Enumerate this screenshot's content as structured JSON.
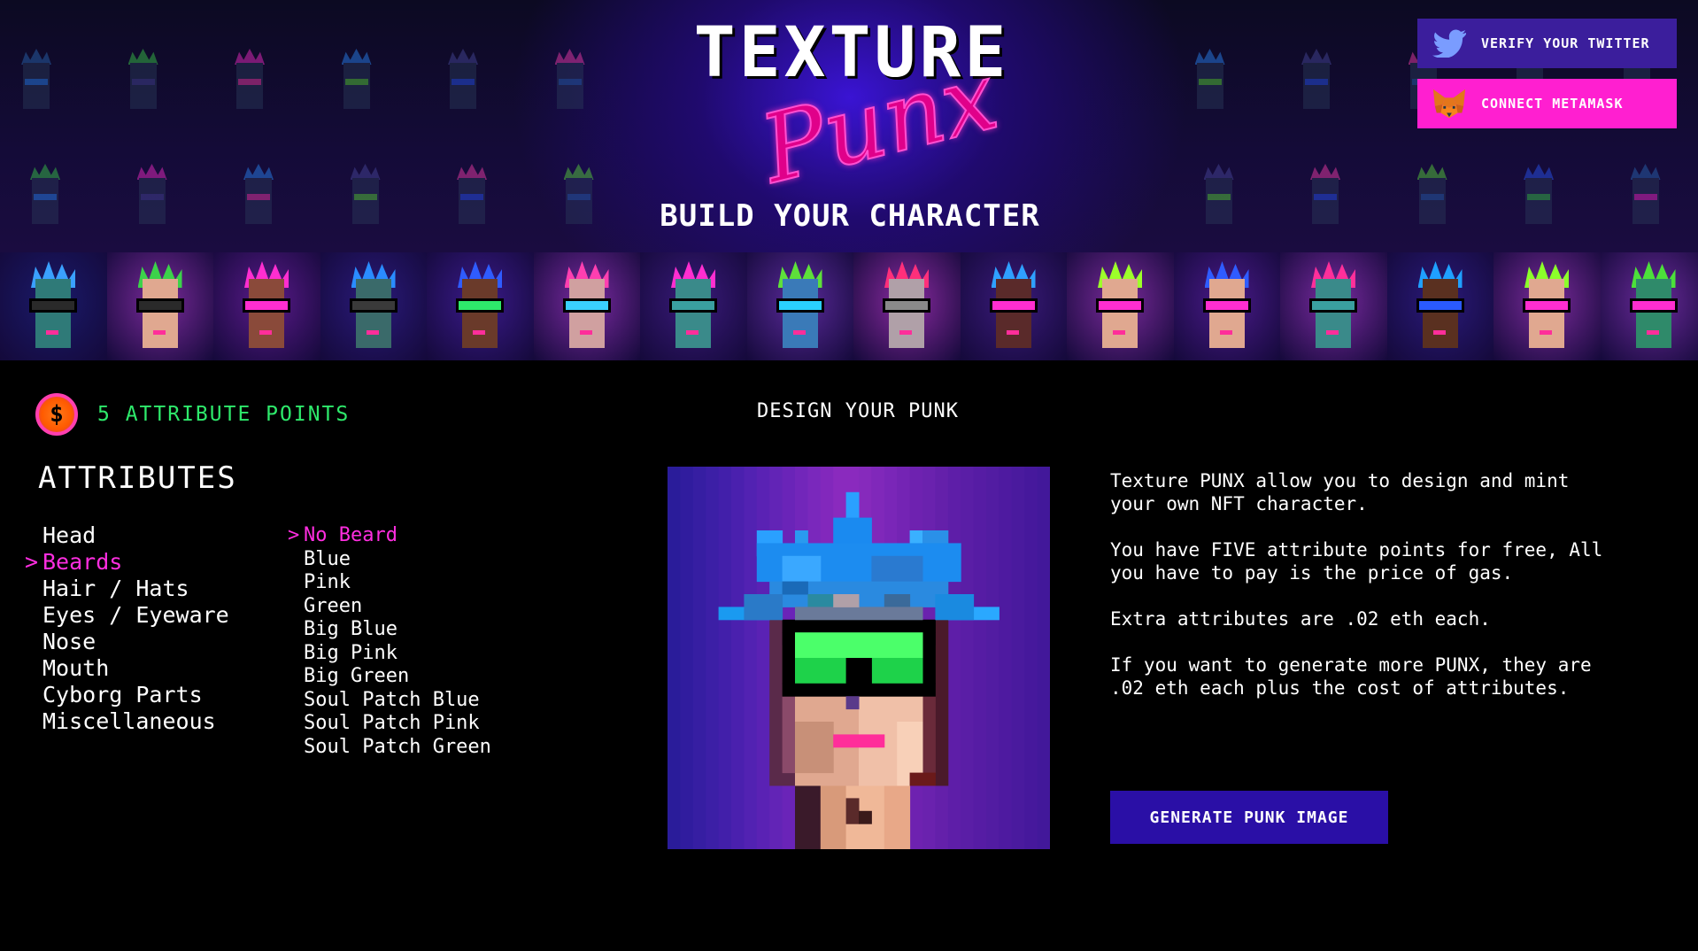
{
  "header": {
    "logo_title": "TEXTURE",
    "logo_script": "Punx",
    "tagline": "BUILD YOUR CHARACTER",
    "twitter_button": "VERIFY YOUR TWITTER",
    "metamask_button": "CONNECT METAMASK"
  },
  "points": {
    "icon": "coin-icon",
    "symbol": "$",
    "label": "5 ATTRIBUTE POINTS"
  },
  "design_title": "DESIGN YOUR PUNK",
  "attributes": {
    "heading": "ATTRIBUTES",
    "active_caret": ">",
    "categories": [
      "Head",
      "Beards",
      "Hair / Hats",
      "Eyes / Eyeware",
      "Nose",
      "Mouth",
      "Cyborg Parts",
      "Miscellaneous"
    ],
    "active_category": "Beards",
    "options": [
      "No Beard",
      "Blue",
      "Pink",
      "Green",
      "Big Blue",
      "Big Pink",
      "Big Green",
      "Soul Patch Blue",
      "Soul Patch Pink",
      "Soul Patch Green"
    ],
    "active_option": "No Beard"
  },
  "description": {
    "p1": "Texture PUNX allow you to design and mint your own NFT character.",
    "p2": "You have FIVE attribute points for free, All you have to pay is the price of gas.",
    "p3": "Extra attributes are .02 eth each.",
    "p4": "If you want to generate more PUNX, they are .02 eth each plus the cost of attributes."
  },
  "generate_button": "GENERATE PUNK IMAGE",
  "colors": {
    "accent_pink": "#ff2ee0",
    "accent_green": "#2ee96b",
    "button_purple": "#2a0fa6",
    "twitter_purple": "#3b1e9c",
    "metamask_pink": "#ff1fd0"
  }
}
